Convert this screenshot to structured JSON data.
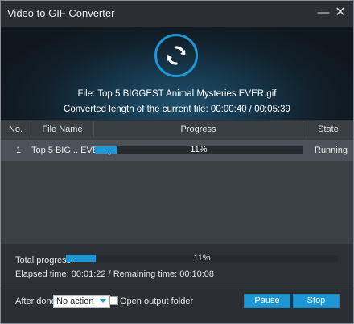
{
  "window": {
    "title": "Video to GIF Converter",
    "minimize_glyph": "—",
    "close_glyph": "✕"
  },
  "hero": {
    "icon": "refresh-icon",
    "file_line": "File: Top 5 BIGGEST Animal Mysteries EVER.gif",
    "length_line": "Converted length of the current file: 00:00:40 / 00:05:39"
  },
  "table": {
    "headers": [
      "No.",
      "File Name",
      "Progress",
      "State"
    ],
    "rows": [
      {
        "no": "1",
        "file_name": "Top 5 BIG... EVER.gif",
        "progress_pct": 11,
        "progress_label": "11%",
        "state": "Running"
      }
    ]
  },
  "totals": {
    "label": "Total progress:",
    "progress_pct": 11,
    "progress_label": "11%",
    "time_line": "Elapsed time: 00:01:22 / Remaining time: 00:10:08"
  },
  "footer": {
    "after_done_label": "After done:",
    "after_done_value": "No action",
    "open_folder_label": "Open output folder",
    "open_folder_checked": false,
    "pause_label": "Pause",
    "stop_label": "Stop"
  },
  "colors": {
    "accent": "#1f97d4",
    "background": "#2d3135",
    "row": "#4c5257"
  }
}
